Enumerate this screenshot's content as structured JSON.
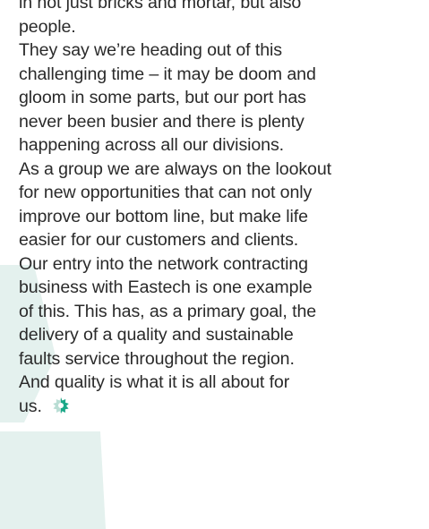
{
  "article": {
    "lines": [
      "in not just bricks and mortar, but also",
      "people.",
      "They say we’re heading out of this",
      "challenging time – it may be doom and",
      "gloom in some parts, but our port has",
      "never been busier and there is plenty",
      "happening across all our divisions.",
      "As a group we are always on the lookout",
      "for new opportunities that can not only",
      "improve our bottom line, but make life",
      "easier for our customers and clients.",
      "Our entry into the network contracting",
      "business with Eastech is one example",
      "of this. This has, as a primary goal, the",
      "delivery of a quality and sustainable",
      "faults service throughout the region.",
      "And quality is what it is all about for",
      "us."
    ]
  },
  "colors": {
    "text": "#2a2a2a",
    "background_shape": "#e4f1ee",
    "end_mark_primary": "#1ba888",
    "end_mark_secondary": "#b9ddd4"
  },
  "icons": {
    "end_mark": "gear-icon",
    "background": "hexagon-shape"
  }
}
